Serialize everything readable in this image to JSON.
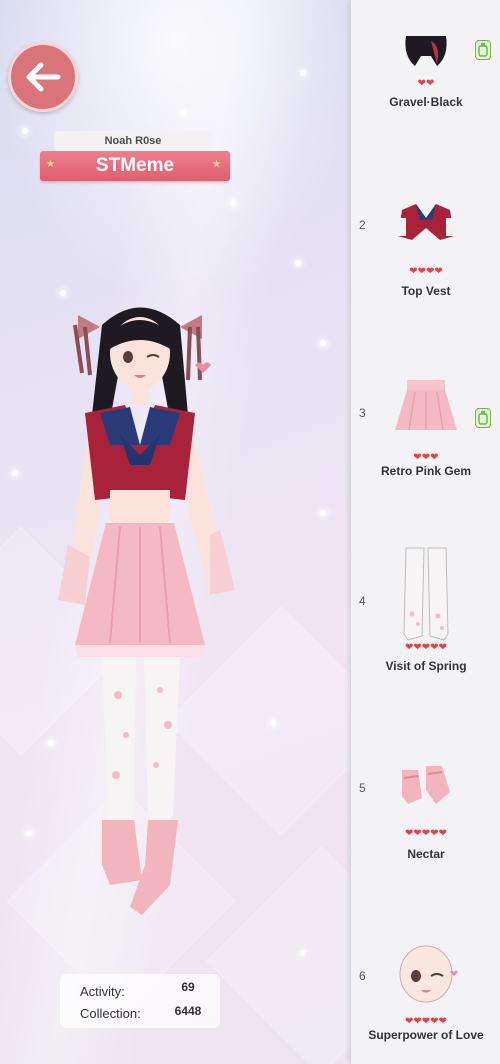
{
  "player": {
    "name": "Noah R0se",
    "title": "STMeme"
  },
  "stats": {
    "activity_label": "Activity:",
    "activity_value": "69",
    "collection_label": "Collection:",
    "collection_value": "6448"
  },
  "colors": {
    "accent": "#e05e70",
    "heart": "#e2404b",
    "back_button": "#d97478"
  },
  "items": [
    {
      "number": "",
      "name": "Gravel·Black",
      "hearts": "❤❤",
      "thumb_icon": "hair-icon",
      "badge": true
    },
    {
      "number": "2",
      "name": "Top Vest",
      "hearts": "❤❤❤❤",
      "thumb_icon": "vest-icon",
      "badge": false
    },
    {
      "number": "3",
      "name": "Retro Pink Gem",
      "hearts": "❤❤❤",
      "thumb_icon": "skirt-icon",
      "badge": true
    },
    {
      "number": "4",
      "name": "Visit of Spring",
      "hearts": "❤❤❤❤❤",
      "thumb_icon": "stockings-icon",
      "badge": false
    },
    {
      "number": "5",
      "name": "Nectar",
      "hearts": "❤❤❤❤❤",
      "thumb_icon": "shoes-icon",
      "badge": false
    },
    {
      "number": "6",
      "name": "Superpower of Love",
      "hearts": "❤❤❤❤❤",
      "thumb_icon": "face-icon",
      "badge": false
    }
  ]
}
